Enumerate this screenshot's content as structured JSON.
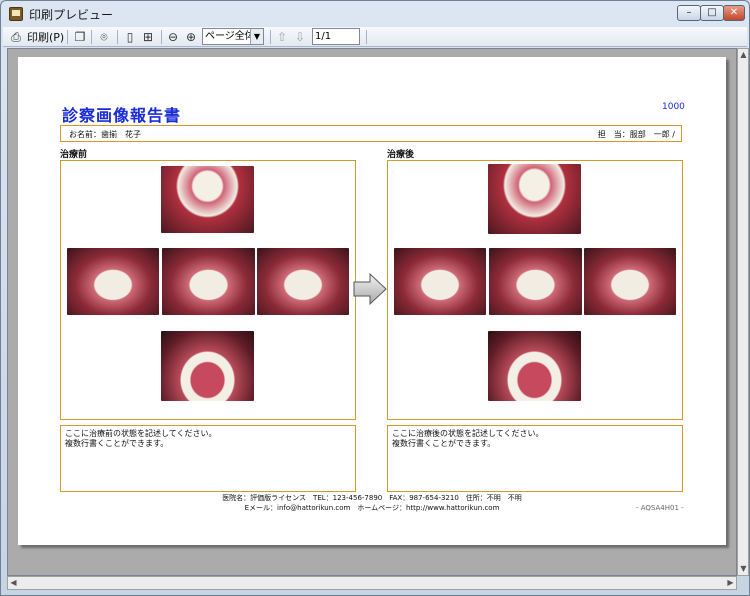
{
  "window": {
    "title": "印刷プレビュー",
    "min": "–",
    "max": "□",
    "close": "✕"
  },
  "toolbar": {
    "print_label": "印刷(P)",
    "zoom_select": "ページ全体",
    "page_field": "1/1"
  },
  "report": {
    "title": "診察画像報告書",
    "number": "1000",
    "name_label": "お名前：歯揃　花子",
    "staff_label": "担　当：服部　一郎 /",
    "before_label": "治療前",
    "after_label": "治療後",
    "before_note": "ここに治療前の状態を記述してください。\n複数行書くことができます。",
    "after_note": "ここに治療後の状態を記述してください。\n複数行書くことができます。",
    "footer_line1": "医院名：評価版ライセンス　TEL：123-456-7890　FAX：987-654-3210　住所：不明　不明",
    "footer_line2": "Eメール：info@hattorikun.com　ホームページ：http://www.hattorikun.com",
    "footer_code": "- AQSA4H01 -"
  }
}
